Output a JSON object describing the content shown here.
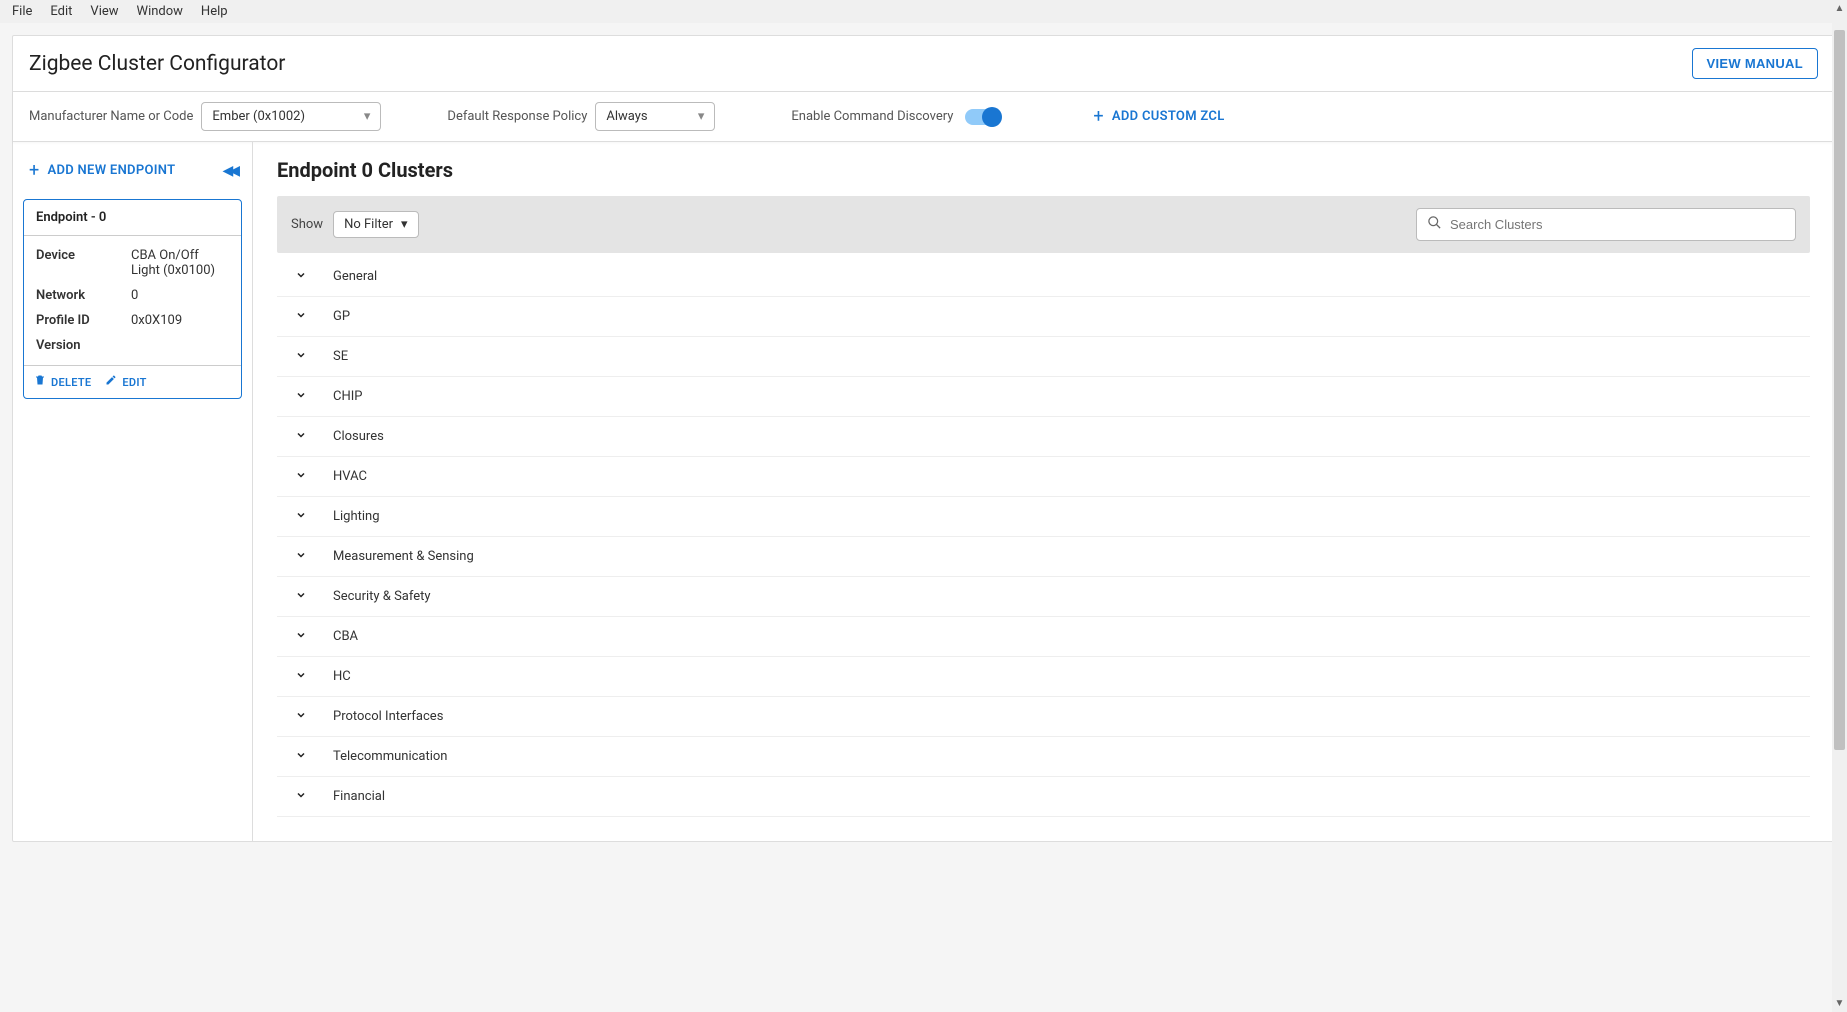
{
  "menu": [
    "File",
    "Edit",
    "View",
    "Window",
    "Help"
  ],
  "header": {
    "title": "Zigbee Cluster Configurator",
    "view_manual": "VIEW MANUAL"
  },
  "toolbar": {
    "manufacturer_label": "Manufacturer Name or Code",
    "manufacturer_value": "Ember (0x1002)",
    "response_label": "Default Response Policy",
    "response_value": "Always",
    "discovery_label": "Enable Command Discovery",
    "add_zcl": "ADD CUSTOM ZCL"
  },
  "sidebar": {
    "add_endpoint": "ADD NEW ENDPOINT",
    "card_title": "Endpoint - 0",
    "rows": [
      {
        "key": "Device",
        "val": "CBA On/Off Light (0x0100)"
      },
      {
        "key": "Network",
        "val": "0"
      },
      {
        "key": "Profile ID",
        "val": "0x0X109"
      },
      {
        "key": "Version",
        "val": ""
      }
    ],
    "delete": "DELETE",
    "edit": "EDIT"
  },
  "main": {
    "title": "Endpoint 0 Clusters",
    "show_label": "Show",
    "filter_value": "No Filter",
    "search_placeholder": "Search Clusters",
    "clusters": [
      "General",
      "GP",
      "SE",
      "CHIP",
      "Closures",
      "HVAC",
      "Lighting",
      "Measurement & Sensing",
      "Security & Safety",
      "CBA",
      "HC",
      "Protocol Interfaces",
      "Telecommunication",
      "Financial"
    ]
  }
}
